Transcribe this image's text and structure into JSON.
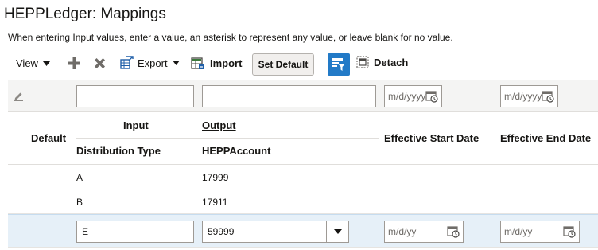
{
  "page": {
    "title": "HEPPLedger: Mappings",
    "instructions": "When entering Input values, enter a value, an asterisk to represent any value, or leave blank for no value."
  },
  "toolbar": {
    "view_label": "View",
    "export_label": "Export",
    "import_label": "Import",
    "set_default_label": "Set Default",
    "detach_label": "Detach"
  },
  "query_row": {
    "start_date_placeholder": "m/d/yyyy",
    "end_date_placeholder": "m/d/yyyy"
  },
  "columns": {
    "default": "Default",
    "input_group": "Input",
    "output_group": "Output",
    "distribution_type": "Distribution Type",
    "hepp_account": "HEPPAccount",
    "effective_start_date": "Effective Start Date",
    "effective_end_date": "Effective End Date"
  },
  "rows": [
    {
      "distribution_type": "A",
      "hepp_account": "17999"
    },
    {
      "distribution_type": "B",
      "hepp_account": "17911"
    }
  ],
  "edit_row": {
    "distribution_type": "E",
    "hepp_account": "59999",
    "start_date_placeholder": "m/d/yy",
    "end_date_placeholder": "m/d/yy"
  },
  "colors": {
    "accent": "#227ac7",
    "selected_row": "#e6f0f8"
  }
}
